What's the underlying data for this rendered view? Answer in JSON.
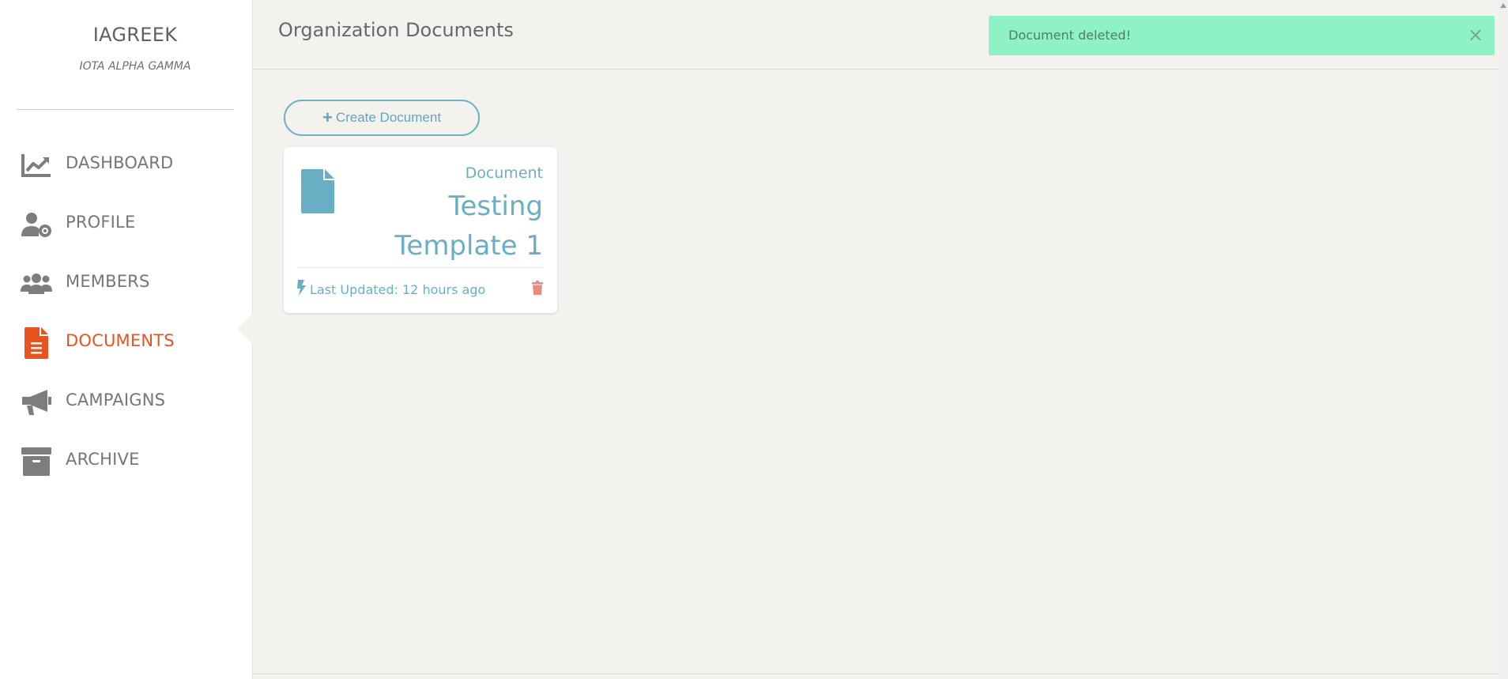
{
  "brand": {
    "name": "IAGREEK",
    "subtitle": "IOTA ALPHA GAMMA"
  },
  "sidebar": {
    "items": [
      {
        "label": "DASHBOARD",
        "icon": "chart-line-icon"
      },
      {
        "label": "PROFILE",
        "icon": "user-gear-icon"
      },
      {
        "label": "MEMBERS",
        "icon": "users-icon"
      },
      {
        "label": "DOCUMENTS",
        "icon": "document-icon",
        "active": true
      },
      {
        "label": "CAMPAIGNS",
        "icon": "megaphone-icon"
      },
      {
        "label": "ARCHIVE",
        "icon": "archive-box-icon"
      }
    ]
  },
  "header": {
    "title": "Organization Documents"
  },
  "toast": {
    "message": "Document deleted!",
    "close": "×"
  },
  "actions": {
    "create_label": "Create Document",
    "create_icon": "+"
  },
  "documents": [
    {
      "kind": "Document",
      "title": "Testing Template 1",
      "updated": "Last Updated: 12 hours ago"
    }
  ],
  "colors": {
    "accent": "#6aaec4",
    "active_nav": "#e8531f",
    "toast_bg": "#8ef2c6",
    "delete": "#e48b86",
    "nav_icon": "#7d7d7d"
  }
}
